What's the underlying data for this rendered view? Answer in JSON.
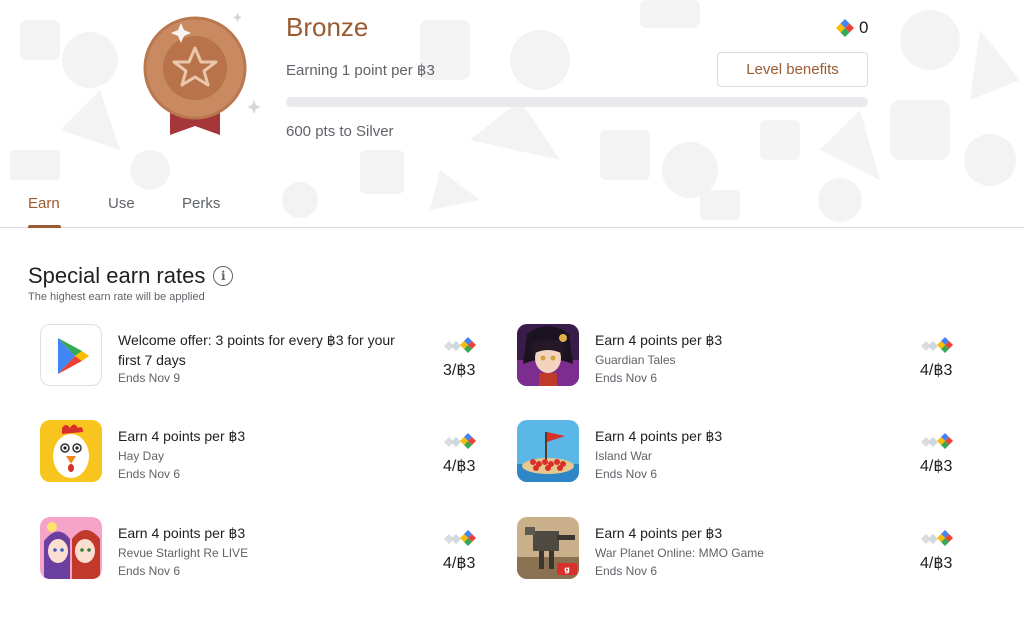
{
  "header": {
    "tier": "Bronze",
    "points_balance": "0",
    "earning_rate": "Earning 1 point per ฿3",
    "level_benefits_label": "Level benefits",
    "progress_fraction": 0,
    "to_next_level": "600 pts to Silver"
  },
  "tabs": [
    {
      "label": "Earn",
      "active": true
    },
    {
      "label": "Use",
      "active": false
    },
    {
      "label": "Perks",
      "active": false
    }
  ],
  "section": {
    "title": "Special earn rates",
    "subtitle": "The highest earn rate will be applied"
  },
  "offers": [
    {
      "headline": "Welcome offer: 3 points for every ฿3 for your first 7 days",
      "app": "",
      "ends": "Ends Nov 9",
      "rate": "3/฿3",
      "icon": "google-play-icon"
    },
    {
      "headline": "Earn 4 points per ฿3",
      "app": "Guardian Tales",
      "ends": "Ends Nov 6",
      "rate": "4/฿3",
      "icon": "guardian-tales-icon"
    },
    {
      "headline": "Earn 4 points per ฿3",
      "app": "Hay Day",
      "ends": "Ends Nov 6",
      "rate": "4/฿3",
      "icon": "hay-day-icon"
    },
    {
      "headline": "Earn 4 points per ฿3",
      "app": "Island War",
      "ends": "Ends Nov 6",
      "rate": "4/฿3",
      "icon": "island-war-icon"
    },
    {
      "headline": "Earn 4 points per ฿3",
      "app": "Revue Starlight Re LIVE",
      "ends": "Ends Nov 6",
      "rate": "4/฿3",
      "icon": "revue-starlight-icon"
    },
    {
      "headline": "Earn 4 points per ฿3",
      "app": "War Planet Online: MMO Game",
      "ends": "Ends Nov 6",
      "rate": "4/฿3",
      "icon": "war-planet-icon"
    }
  ],
  "colors": {
    "bronze_accent": "#9a5b31",
    "medal_face": "#c98a62",
    "ribbon": "#a5373a",
    "progress_track": "#e8eaed"
  }
}
